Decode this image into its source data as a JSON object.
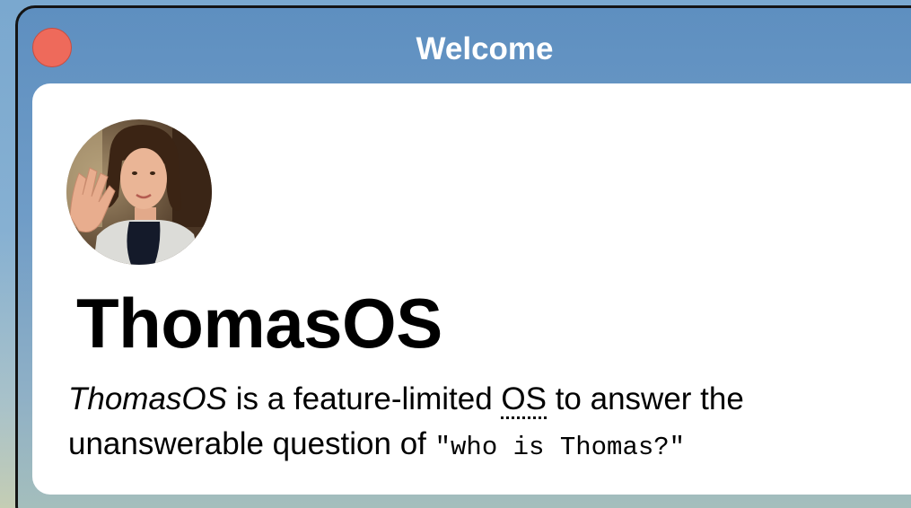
{
  "window": {
    "title": "Welcome",
    "close_button": {
      "color": "#ee6a5b",
      "icon": "close-icon"
    }
  },
  "profile": {
    "avatar_icon": "user-photo-avatar"
  },
  "main": {
    "heading": "ThomasOS",
    "description": {
      "emphasis": "ThomasOS",
      "part1": " is a feature-limited ",
      "abbr": "OS",
      "part2": " to answer the unanswerable question of ",
      "code": "\"who is Thomas?\""
    }
  },
  "colors": {
    "titlebar": "#6f9cc7",
    "content_bg": "#ffffff",
    "title_text": "#ffffff"
  }
}
